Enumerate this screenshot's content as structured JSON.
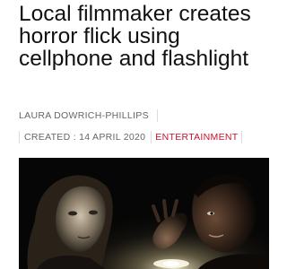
{
  "article": {
    "headline": "Local filmmaker creates horror flick using cellphone and flashlight",
    "author": "LAURA DOWRICH-PHILLIPS",
    "created": "CREATED : 14 APRIL 2020",
    "category": "ENTERTAINMENT"
  },
  "colors": {
    "category": "#c8102e",
    "meta_text": "#666666",
    "headline_text": "#111111"
  }
}
